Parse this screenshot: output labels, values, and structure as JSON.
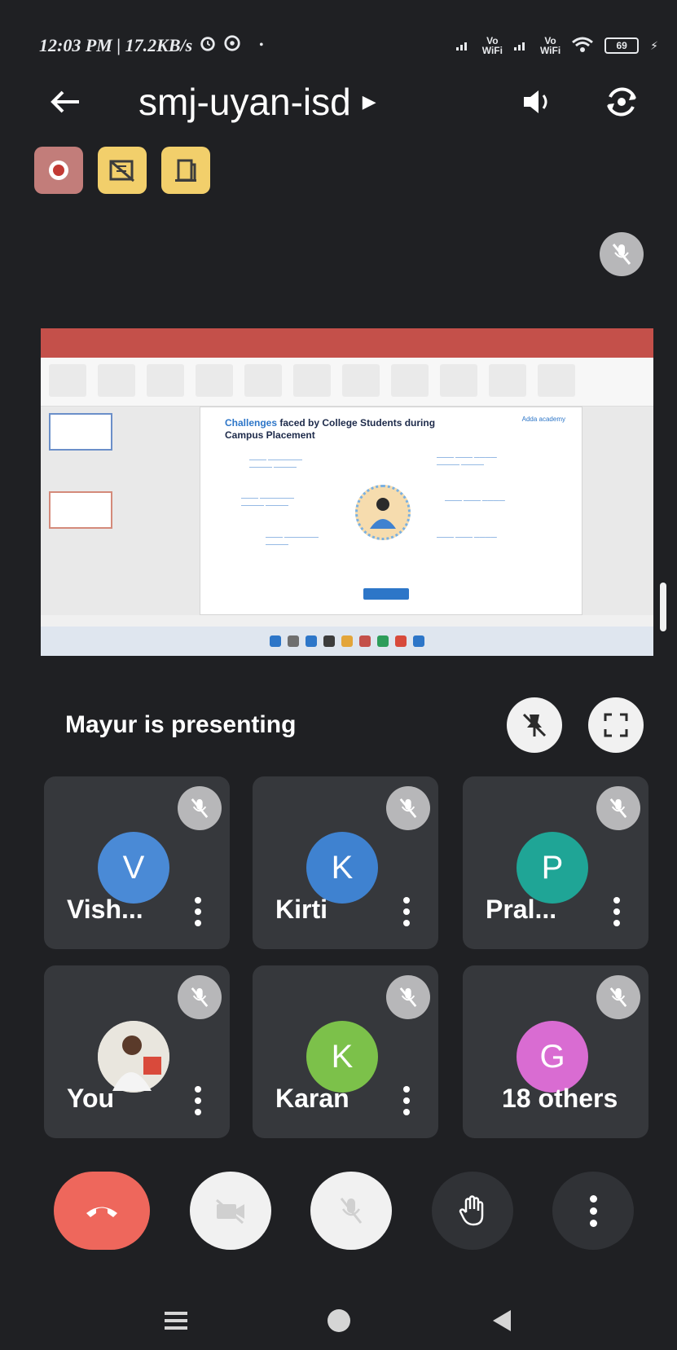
{
  "status_bar": {
    "time_speed": "12:03 PM | 17.2KB/s",
    "vo_top": "Vo",
    "wifi_word": "WiFi",
    "battery": "69"
  },
  "header": {
    "title": "smj-uyan-isd"
  },
  "presentation": {
    "slide_title_highlight": "Challenges",
    "slide_title_rest": " faced by College Students during Campus Placement",
    "slide_logo": "Adda academy",
    "presenter_text": "Mayur is presenting"
  },
  "participants": [
    {
      "name": "Vish...",
      "initial": "V",
      "color": "#4a8ad6"
    },
    {
      "name": "Kirti",
      "initial": "K",
      "color": "#3f82d0"
    },
    {
      "name": "Pral...",
      "initial": "P",
      "color": "#1fa596"
    },
    {
      "name": "You",
      "initial": "",
      "color": "#d9d9d9"
    },
    {
      "name": "Karan",
      "initial": "K",
      "color": "#7cc14a"
    },
    {
      "name": "18 others",
      "initial": "G",
      "color": "#d96cd2"
    }
  ]
}
